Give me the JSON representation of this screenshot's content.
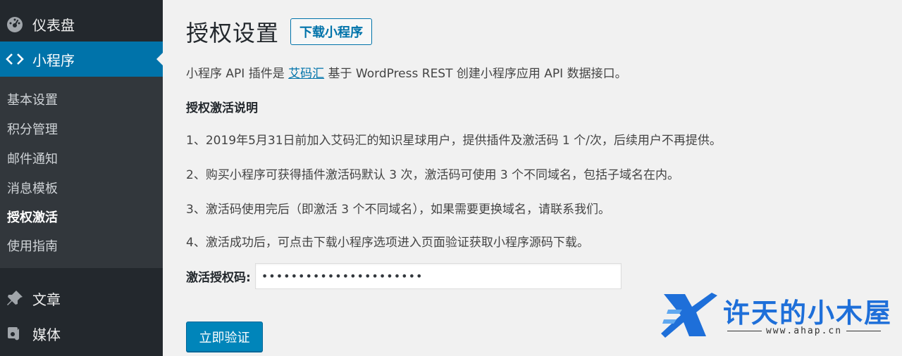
{
  "sidebar": {
    "dashboard": "仪表盘",
    "miniprogram": "小程序",
    "submenu": [
      "基本设置",
      "积分管理",
      "邮件通知",
      "消息模板",
      "授权激活",
      "使用指南"
    ],
    "posts": "文章",
    "media": "媒体"
  },
  "page": {
    "title": "授权设置",
    "title_button": "下载小程序",
    "intro_before": "小程序 API 插件是 ",
    "intro_link": "艾码汇",
    "intro_after": " 基于 WordPress REST 创建小程序应用 API 数据接口。",
    "heading": "授权激活说明",
    "items": [
      "1、2019年5月31日前加入艾码汇的知识星球用户，提供插件及激活码 1 个/次，后续用户不再提供。",
      "2、购买小程序可获得插件激活码默认 3 次，激活码可使用 3 个不同域名，包括子域名在内。",
      "3、激活码使用完后（即激活 3 个不同域名），如果需要更换域名，请联系我们。",
      "4、激活成功后，可点击下载小程序选项进入页面验证获取小程序源码下载。"
    ],
    "field_label": "激活授权码:",
    "field_value": "••••••••••••••••••••••",
    "verify_button": "立即验证"
  },
  "watermark": {
    "title": "许天的小木屋",
    "url": "www.ahap.cn"
  },
  "colors": {
    "sidebar_bg": "#23282d",
    "submenu_bg": "#32373c",
    "accent": "#0073aa",
    "button": "#0085ba"
  }
}
